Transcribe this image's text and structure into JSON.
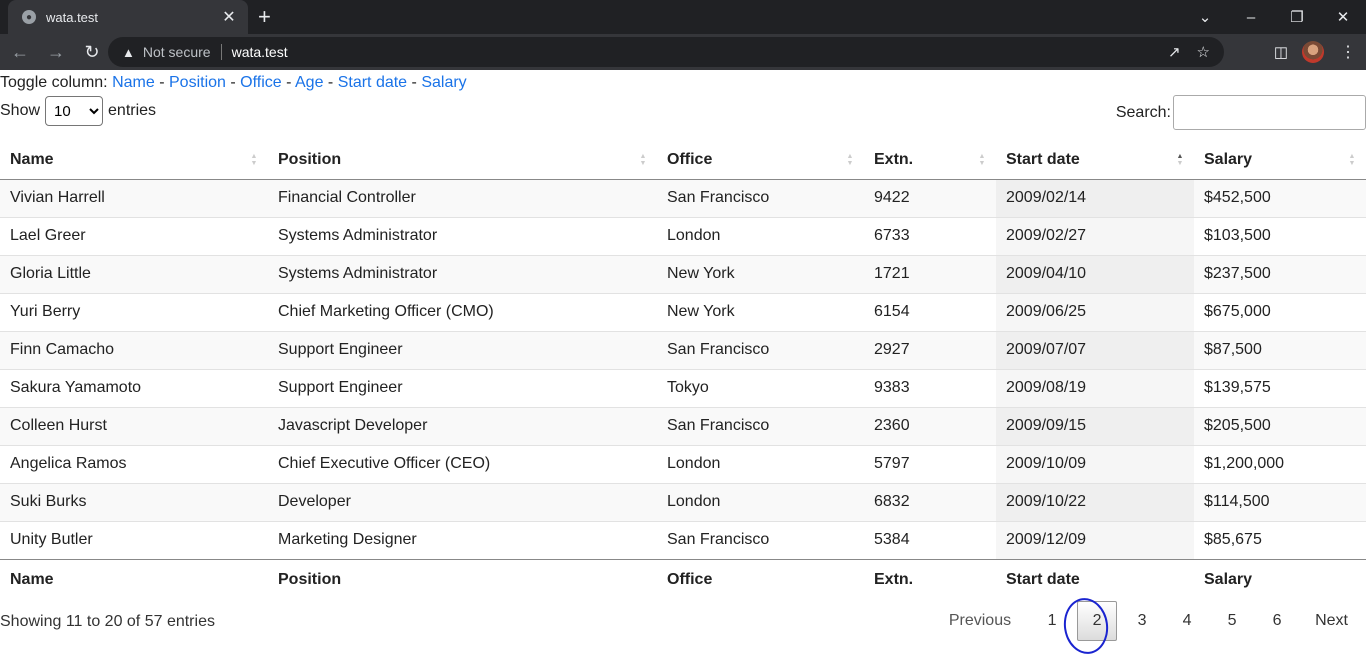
{
  "browser": {
    "tab_title": "wata.test",
    "security_label": "Not secure",
    "url": "wata.test"
  },
  "toggle": {
    "prefix": "Toggle column:",
    "columns": [
      "Name",
      "Position",
      "Office",
      "Age",
      "Start date",
      "Salary"
    ]
  },
  "length": {
    "show_label": "Show",
    "selected": "10",
    "entries_label": "entries"
  },
  "search": {
    "label": "Search:",
    "value": ""
  },
  "table": {
    "headers": [
      "Name",
      "Position",
      "Office",
      "Extn.",
      "Start date",
      "Salary"
    ],
    "sorted_column": "Start date",
    "sort_direction": "ascending",
    "rows": [
      [
        "Vivian Harrell",
        "Financial Controller",
        "San Francisco",
        "9422",
        "2009/02/14",
        "$452,500"
      ],
      [
        "Lael Greer",
        "Systems Administrator",
        "London",
        "6733",
        "2009/02/27",
        "$103,500"
      ],
      [
        "Gloria Little",
        "Systems Administrator",
        "New York",
        "1721",
        "2009/04/10",
        "$237,500"
      ],
      [
        "Yuri Berry",
        "Chief Marketing Officer (CMO)",
        "New York",
        "6154",
        "2009/06/25",
        "$675,000"
      ],
      [
        "Finn Camacho",
        "Support Engineer",
        "San Francisco",
        "2927",
        "2009/07/07",
        "$87,500"
      ],
      [
        "Sakura Yamamoto",
        "Support Engineer",
        "Tokyo",
        "9383",
        "2009/08/19",
        "$139,575"
      ],
      [
        "Colleen Hurst",
        "Javascript Developer",
        "San Francisco",
        "2360",
        "2009/09/15",
        "$205,500"
      ],
      [
        "Angelica Ramos",
        "Chief Executive Officer (CEO)",
        "London",
        "5797",
        "2009/10/09",
        "$1,200,000"
      ],
      [
        "Suki Burks",
        "Developer",
        "London",
        "6832",
        "2009/10/22",
        "$114,500"
      ],
      [
        "Unity Butler",
        "Marketing Designer",
        "San Francisco",
        "5384",
        "2009/12/09",
        "$85,675"
      ]
    ]
  },
  "info": "Showing 11 to 20 of 57 entries",
  "pagination": {
    "previous": "Previous",
    "next": "Next",
    "pages": [
      "1",
      "2",
      "3",
      "4",
      "5",
      "6"
    ],
    "current": "2"
  }
}
